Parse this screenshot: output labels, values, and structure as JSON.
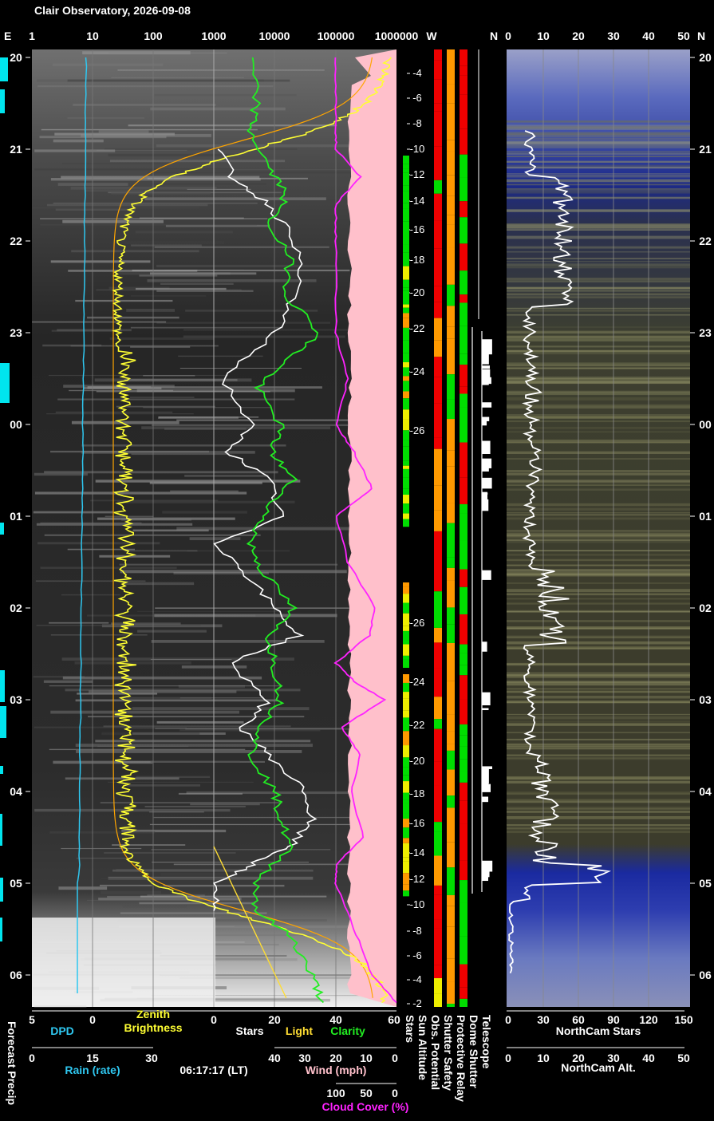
{
  "title": "Clair Observatory, 2026-09-08",
  "colors": {
    "background": "#000000",
    "text": "#ffffff",
    "dpd": "#2fc7f0",
    "rain": "#2fc7f0",
    "zenith": "#ffff33",
    "stars": "#ffffff",
    "light": "#ffdd33",
    "clarity": "#22ee22",
    "wind": "#ffc0cb",
    "cloud": "#ff22ff",
    "sun_curve": "#ffa500",
    "status_red": "#ee0000",
    "status_orange": "#ff9900",
    "status_green": "#00dd00",
    "status_yellow": "#eeee00",
    "forecast": "#00e5ee"
  },
  "top_axis": {
    "left_edge_label": "E",
    "log_ticks": [
      "1",
      "10",
      "100",
      "1000",
      "10000",
      "100000",
      "1000000"
    ],
    "west_label": "W",
    "north_label": "N",
    "alt_ticks": [
      "0",
      "10",
      "20",
      "30",
      "40",
      "50"
    ],
    "right_edge_label": "N"
  },
  "time_labels": [
    "20",
    "21",
    "22",
    "23",
    "00",
    "01",
    "02",
    "03",
    "04",
    "05",
    "06"
  ],
  "sun_altitude_labels": [
    "-2",
    "-4",
    "-6",
    "-8",
    "-10",
    "-12",
    "-14",
    "-16",
    "-18",
    "-20",
    "-22",
    "-24",
    "-26"
  ],
  "bottom": {
    "forecast_precip": "Forecast Precip",
    "dpd": {
      "label": "DPD",
      "ticks": [
        "5",
        "0"
      ]
    },
    "rain": {
      "label": "Rain (rate)",
      "ticks": [
        "0",
        "15",
        "30"
      ]
    },
    "zenith": {
      "label_line1": "Zenith",
      "label_line2": "Brightness"
    },
    "stars_light_clarity": {
      "ticks": [
        "0",
        "20",
        "40",
        "60"
      ],
      "stars": "Stars",
      "light": "Light",
      "clarity": "Clarity"
    },
    "wind": {
      "label": "Wind (mph)",
      "ticks": [
        "40",
        "30",
        "20",
        "10",
        "0"
      ]
    },
    "cloud": {
      "label": "Cloud Cover (%)",
      "ticks": [
        "100",
        "50",
        "0"
      ]
    },
    "timestamp": "06:17:17 (LT)",
    "vertical_labels": [
      "Stars",
      "Sun Altitude",
      "Obs. Potential",
      "Shutter Safety",
      "Protective Relay",
      "Dome Shutter",
      "Telescope"
    ],
    "northcam_stars": {
      "label": "NorthCam Stars",
      "ticks": [
        "0",
        "30",
        "60",
        "90",
        "120",
        "150"
      ]
    },
    "northcam_alt": {
      "label": "NorthCam Alt.",
      "ticks": [
        "0",
        "10",
        "20",
        "30",
        "40",
        "50"
      ]
    }
  },
  "chart_data": {
    "type": "line",
    "time_axis": {
      "start": "20:00",
      "end": "06:17",
      "unit": "hour"
    },
    "series": [
      {
        "name": "Stars",
        "axis": "0-60",
        "t": [
          21.0,
          21.3,
          21.6,
          22.0,
          22.5,
          23.0,
          23.5,
          24.0,
          24.3,
          24.6,
          25.0,
          25.3,
          25.6,
          26.0,
          26.3,
          26.6,
          27.0,
          27.3,
          27.6,
          28.0,
          28.3,
          28.6,
          28.8,
          29.0,
          29.3
        ],
        "values": [
          2,
          6,
          18,
          27,
          28,
          20,
          3,
          12,
          5,
          18,
          22,
          1,
          10,
          20,
          28,
          5,
          18,
          9,
          18,
          30,
          32,
          25,
          12,
          1,
          0
        ]
      },
      {
        "name": "Clarity",
        "axis": "0-60",
        "t": [
          20.0,
          20.5,
          20.8,
          21.2,
          21.5,
          21.8,
          22.2,
          22.6,
          23.0,
          23.3,
          23.6,
          24.0,
          24.3,
          24.6,
          25.0,
          25.3,
          25.6,
          26.0,
          26.3,
          26.6,
          27.0,
          27.3,
          27.6,
          28.0,
          28.3,
          28.6,
          29.0,
          29.3,
          29.6,
          30.0,
          30.3
        ],
        "values": [
          12,
          14,
          12,
          18,
          24,
          18,
          25,
          24,
          35,
          24,
          14,
          22,
          19,
          26,
          16,
          12,
          16,
          26,
          18,
          20,
          22,
          16,
          12,
          20,
          22,
          25,
          14,
          14,
          26,
          32,
          36
        ]
      },
      {
        "name": "Cloud Cover",
        "axis": "%",
        "t": [
          20.0,
          20.5,
          20.8,
          21.0,
          21.3,
          21.6,
          22.0,
          23.0,
          23.5,
          24.0,
          24.3,
          24.7,
          25.0,
          25.5,
          26.0,
          26.3,
          26.6,
          26.8,
          27.0,
          27.3,
          27.6,
          28.0,
          28.5,
          28.8,
          29.0,
          29.5,
          30.0,
          30.3
        ],
        "values": [
          100,
          100,
          100,
          100,
          60,
          100,
          100,
          100,
          80,
          100,
          70,
          40,
          100,
          80,
          35,
          45,
          100,
          70,
          20,
          90,
          60,
          75,
          55,
          100,
          100,
          70,
          40,
          0
        ]
      }
    ],
    "status_bars": [
      "Obs. Potential",
      "Shutter Safety",
      "Protective Relay",
      "Dome Shutter",
      "Telescope"
    ]
  }
}
